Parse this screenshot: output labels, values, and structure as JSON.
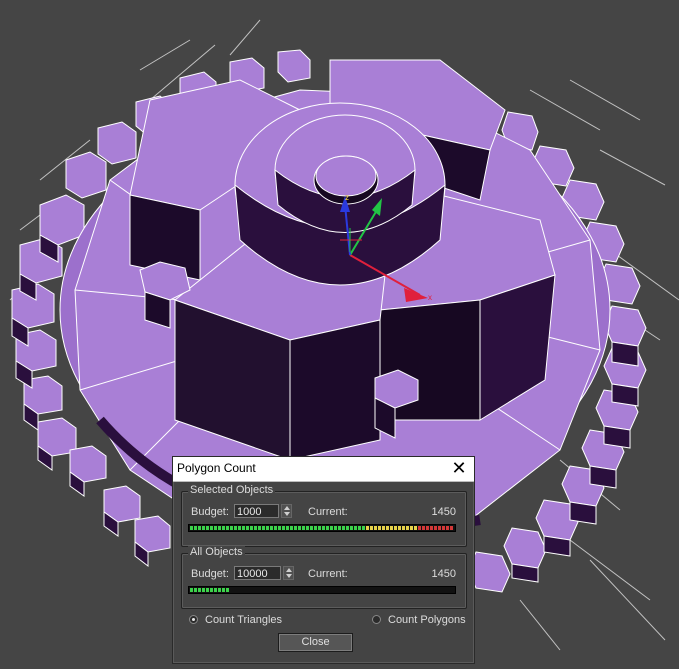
{
  "dialog": {
    "title": "Polygon Count",
    "close_glyph": "✕"
  },
  "selected_objects": {
    "group_label": "Selected Objects",
    "budget_label": "Budget:",
    "budget_value": "1000",
    "current_label": "Current:",
    "current_value": "1450",
    "meter_fraction": 1.0
  },
  "all_objects": {
    "group_label": "All Objects",
    "budget_label": "Budget:",
    "budget_value": "10000",
    "current_label": "Current:",
    "current_value": "1450",
    "meter_fraction": 0.145
  },
  "options": {
    "count_triangles_label": "Count Triangles",
    "count_triangles_selected": true,
    "count_polygons_label": "Count Polygons",
    "count_polygons_selected": false
  },
  "close_button_label": "Close",
  "gizmo": {
    "z_label": "z",
    "x_label": "x"
  },
  "colors": {
    "gear_face": "#a97fd6",
    "gear_side": "#2a0f3d",
    "wire": "#ffffff",
    "meter_green": "#3cd34b",
    "meter_yellow": "#e6d24a",
    "meter_red": "#d43838",
    "gizmo_x": "#e0203c",
    "gizmo_y": "#22c545",
    "gizmo_z": "#2a3ae0"
  }
}
